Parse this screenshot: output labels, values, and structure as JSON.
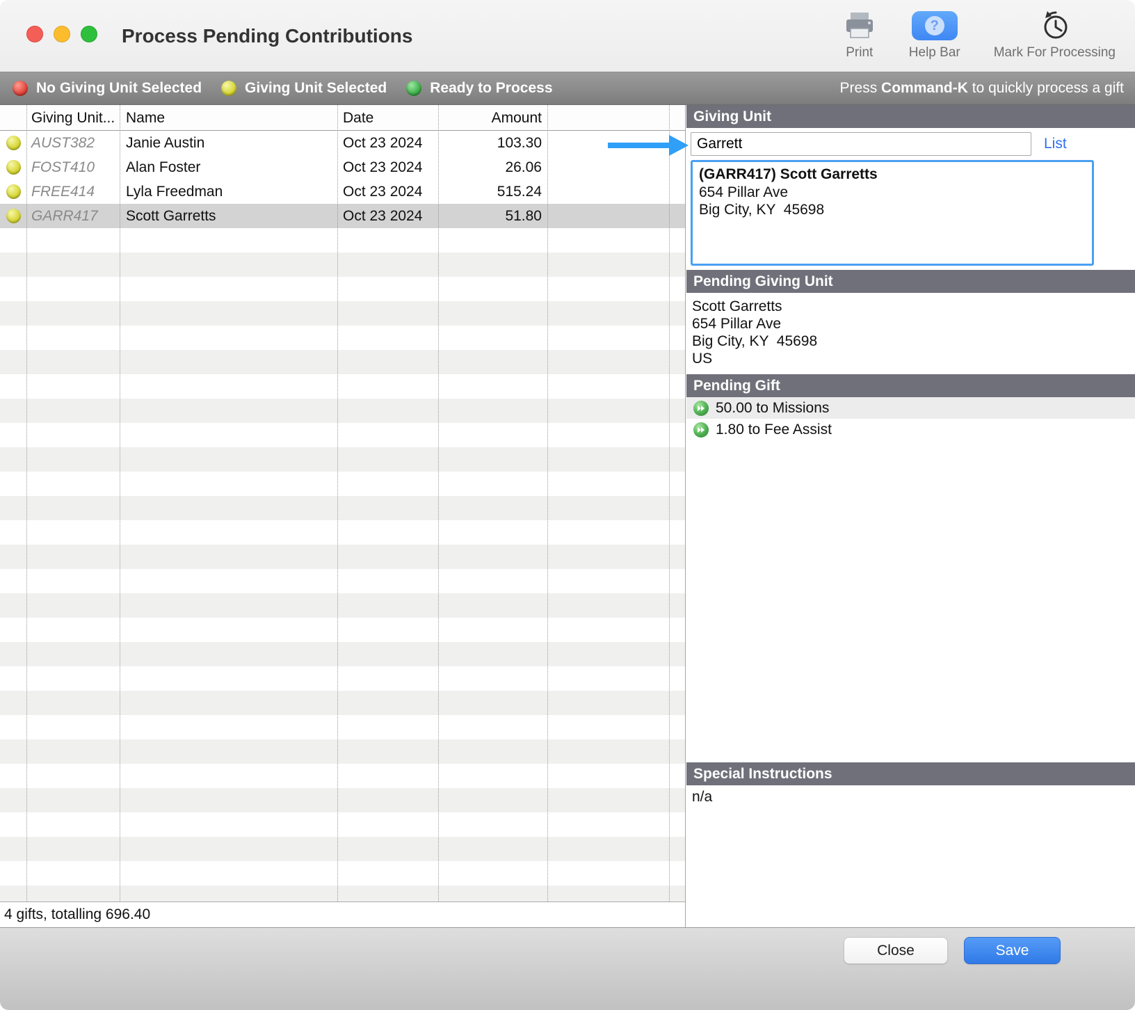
{
  "window": {
    "title": "Process Pending Contributions",
    "toolbar": {
      "print_label": "Print",
      "help_label": "Help Bar",
      "help_glyph": "?",
      "mark_label": "Mark For Processing"
    }
  },
  "legend": {
    "items": [
      {
        "label": "No Giving Unit Selected",
        "status": "red"
      },
      {
        "label": "Giving Unit Selected",
        "status": "yellow"
      },
      {
        "label": "Ready to Process",
        "status": "green"
      }
    ],
    "shortcut": {
      "prefix": "Press",
      "key": "Command-K",
      "suffix": "to quickly process a gift"
    }
  },
  "table": {
    "columns": {
      "unit": "Giving Unit...",
      "name": "Name",
      "date": "Date",
      "amount": "Amount"
    },
    "rows": [
      {
        "unit": "AUST382",
        "name": "Janie Austin",
        "date": "Oct 23 2024",
        "amount": "103.30",
        "status": "yellow",
        "selected": false
      },
      {
        "unit": "FOST410",
        "name": "Alan Foster",
        "date": "Oct 23 2024",
        "amount": "26.06",
        "status": "yellow",
        "selected": false
      },
      {
        "unit": "FREE414",
        "name": "Lyla Freedman",
        "date": "Oct 23 2024",
        "amount": "515.24",
        "status": "yellow",
        "selected": false
      },
      {
        "unit": "GARR417",
        "name": "Scott Garretts",
        "date": "Oct 23 2024",
        "amount": "51.80",
        "status": "yellow",
        "selected": true
      }
    ],
    "summary": "4 gifts, totalling 696.40"
  },
  "panel": {
    "giving_unit": {
      "header": "Giving Unit",
      "search_value": "Garrett",
      "list_link": "List",
      "result_title": "(GARR417) Scott Garretts",
      "result_line1": "654 Pillar Ave",
      "result_line2": "Big City, KY  45698"
    },
    "pending_giving_unit": {
      "header": "Pending Giving Unit",
      "lines": [
        "Scott Garretts",
        "654 Pillar Ave",
        "Big City, KY  45698",
        "US"
      ]
    },
    "pending_gift": {
      "header": "Pending Gift",
      "items": [
        {
          "text": "50.00 to Missions"
        },
        {
          "text": "1.80 to Fee Assist"
        }
      ]
    },
    "special_instructions": {
      "header": "Special Instructions",
      "value": "n/a"
    }
  },
  "actions": {
    "close_label": "Close",
    "save_label": "Save"
  },
  "colors": {
    "accent_blue": "#3e87f5",
    "selection_border": "#4aa0f2",
    "section_header": "#70707a",
    "status_red": "#df4138",
    "status_yellow": "#d8d834",
    "status_green": "#3fae4a"
  }
}
